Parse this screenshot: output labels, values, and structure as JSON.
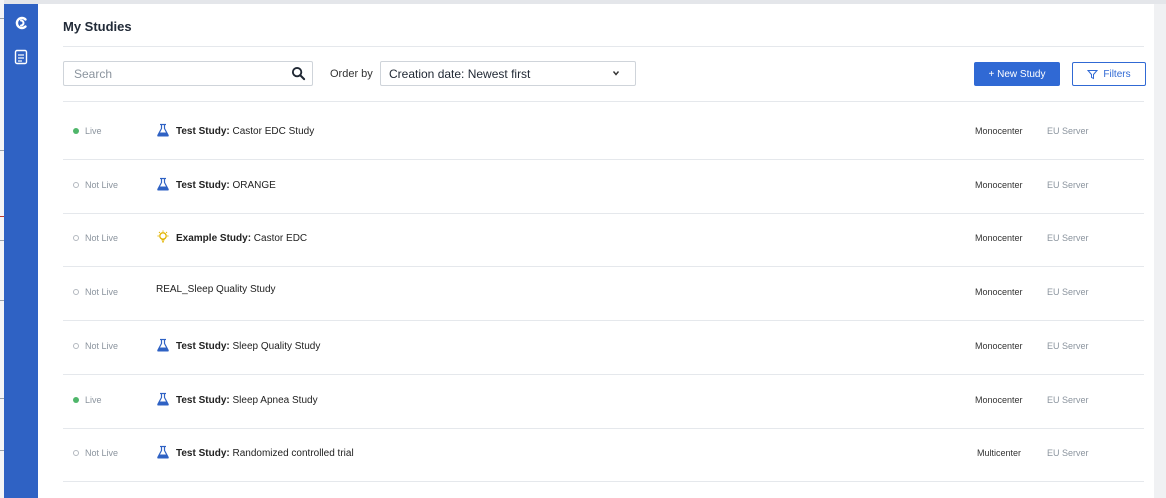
{
  "page": {
    "title": "My Studies"
  },
  "sidebar": {
    "logo_icon": "castor-logo-icon",
    "items": [
      {
        "icon": "document-icon"
      }
    ]
  },
  "toolbar": {
    "search_placeholder": "Search",
    "order_label": "Order by",
    "order_value": "Creation date: Newest first",
    "new_study_label": "+ New Study",
    "filters_label": "Filters"
  },
  "studies": [
    {
      "status": "Live",
      "prefix": "Test Study:",
      "name": " Castor EDC Study",
      "icon": "flask-icon",
      "type": "Monocenter",
      "server": "EU Server"
    },
    {
      "status": "Not Live",
      "prefix": "Test Study:",
      "name": " ORANGE",
      "icon": "flask-icon",
      "type": "Monocenter",
      "server": "EU Server"
    },
    {
      "status": "Not Live",
      "prefix": "Example Study:",
      "name": " Castor EDC",
      "icon": "lightbulb-icon",
      "type": "Monocenter",
      "server": "EU Server"
    },
    {
      "status": "Not Live",
      "prefix": "",
      "name": "REAL_Sleep Quality Study",
      "icon": "",
      "type": "Monocenter",
      "server": "EU Server"
    },
    {
      "status": "Not Live",
      "prefix": "Test Study:",
      "name": " Sleep Quality Study",
      "icon": "flask-icon",
      "type": "Monocenter",
      "server": "EU Server"
    },
    {
      "status": "Live",
      "prefix": "Test Study:",
      "name": " Sleep Apnea Study",
      "icon": "flask-icon",
      "type": "Monocenter",
      "server": "EU Server"
    },
    {
      "status": "Not Live",
      "prefix": "Test Study:",
      "name": " Randomized controlled trial",
      "icon": "flask-icon",
      "type": "Multicenter",
      "server": "EU Server"
    }
  ],
  "colors": {
    "sidebar": "#2f62c4",
    "accent": "#3069d4",
    "live": "#4fb66a",
    "muted": "#8b949e",
    "lightbulb": "#e2b400"
  }
}
